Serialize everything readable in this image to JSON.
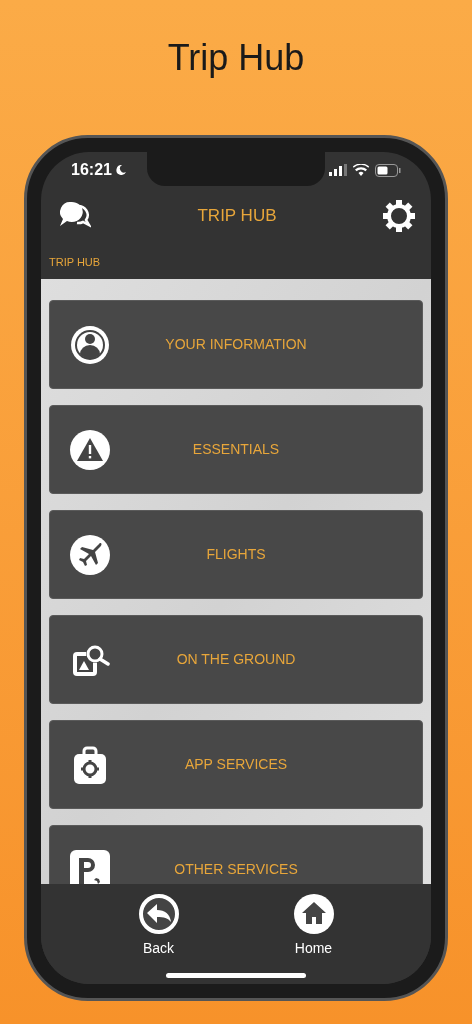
{
  "page_title": "Trip Hub",
  "status_bar": {
    "time": "16:21"
  },
  "header": {
    "title": "TRIP HUB"
  },
  "breadcrumb": "TRIP HUB",
  "menu_items": [
    {
      "label": "YOUR INFORMATION"
    },
    {
      "label": "ESSENTIALS"
    },
    {
      "label": "FLIGHTS"
    },
    {
      "label": "ON THE GROUND"
    },
    {
      "label": "APP SERVICES"
    },
    {
      "label": "OTHER SERVICES"
    }
  ],
  "bottom_nav": [
    {
      "label": "Back"
    },
    {
      "label": "Home"
    }
  ]
}
